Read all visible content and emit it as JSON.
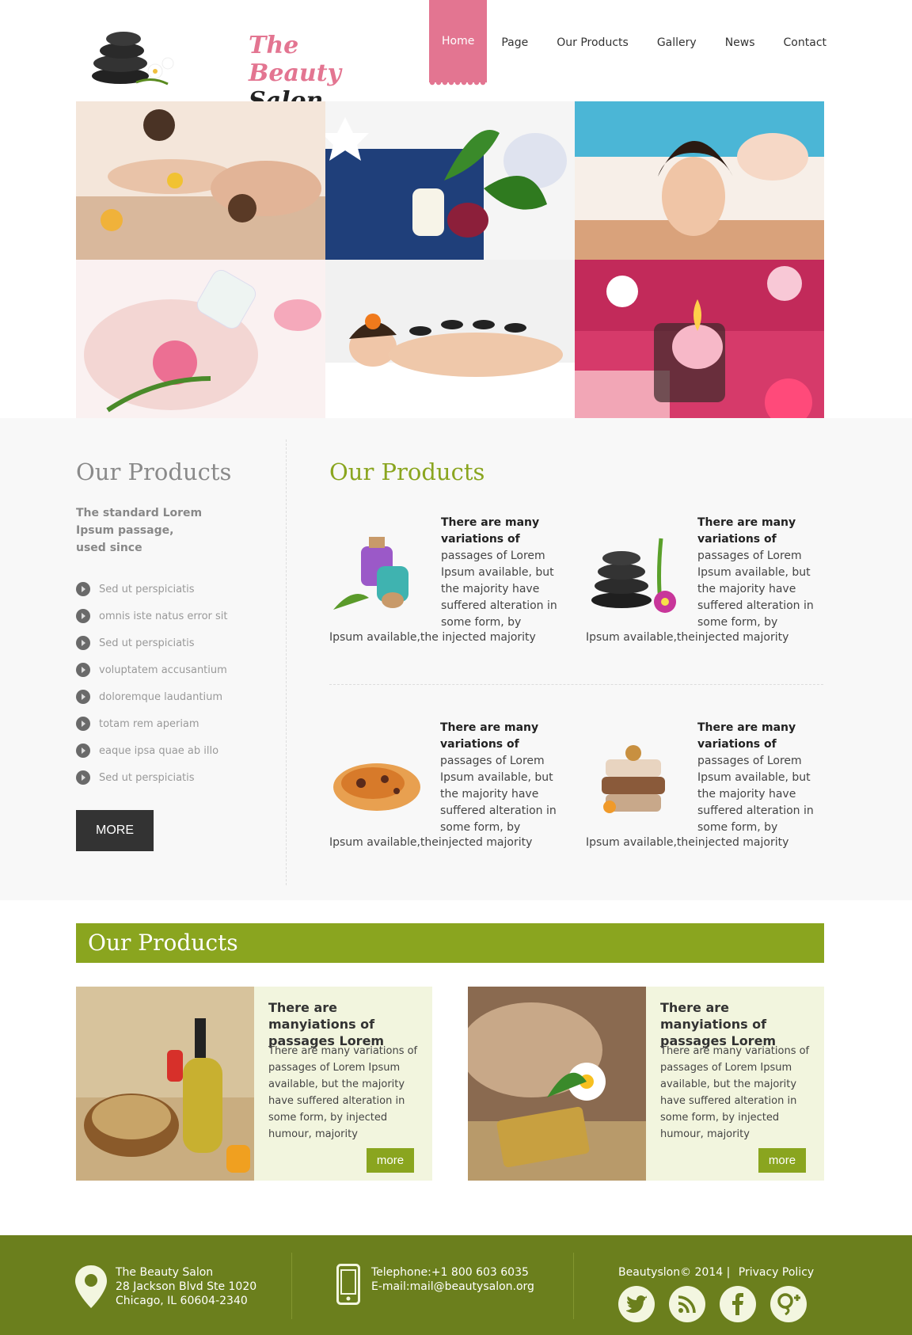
{
  "logo": {
    "part1": "The Beauty",
    "part2": "Salon"
  },
  "nav": [
    {
      "label": "Home"
    },
    {
      "label": "Page"
    },
    {
      "label": "Our Products"
    },
    {
      "label": "Gallery"
    },
    {
      "label": "News"
    },
    {
      "label": "Contact"
    }
  ],
  "sidebar": {
    "title": "Our Products",
    "subtitle": "The standard Lorem Ipsum passage, used since",
    "items": [
      "Sed ut perspiciatis",
      "omnis iste natus error sit",
      "Sed ut perspiciatis",
      "voluptatem accusantium",
      "doloremque laudantium",
      "totam rem aperiam",
      "eaque ipsa quae ab illo",
      "Sed ut perspiciatis"
    ],
    "more_label": "MORE"
  },
  "main": {
    "title": "Our Products",
    "products": [
      {
        "bold": "There are many variations of",
        "text": "passages of Lorem Ipsum available, but the majority have suffered alteration in some form, by",
        "last": "Ipsum available,the  injected majority"
      },
      {
        "bold": "There are many variations of",
        "text": "passages of Lorem Ipsum available, but the majority have suffered alteration in some form, by",
        "last": "Ipsum available,theinjected majority"
      },
      {
        "bold": "There are many variations of",
        "text": "passages of Lorem Ipsum available, but the majority have suffered alteration in some form, by",
        "last": "Ipsum available,theinjected majority"
      },
      {
        "bold": "There are many variations of",
        "text": "passages of Lorem Ipsum available, but the majority have suffered alteration in some form, by",
        "last": "Ipsum available,theinjected  majority"
      }
    ]
  },
  "featured": {
    "title": "Our Products",
    "cards": [
      {
        "title": "There are manyiations of passages Lorem",
        "body": "There are many variations of passages of Lorem Ipsum available, but the majority have suffered alteration in some form, by injected humour, majority",
        "more": "more"
      },
      {
        "title": "There are manyiations of passages Lorem",
        "body": "There are many variations of passages of Lorem Ipsum available, but the majority have suffered alteration in some form, by injected humour, majority",
        "more": "more"
      }
    ]
  },
  "footer": {
    "address": [
      "The Beauty Salon",
      "28 Jackson Blvd Ste 1020",
      "Chicago, IL 60604-2340"
    ],
    "telephone": "Telephone:+1 800 603 6035",
    "email": "E-mail:mail@beautysalon.org",
    "copyright": "Beautyslon© 2014 |",
    "privacy": "Privacy Policy",
    "social": [
      "twitter-icon",
      "rss-icon",
      "facebook-icon",
      "google-plus-icon"
    ]
  },
  "colors": {
    "pink": "#e37591",
    "green": "#8aa51f",
    "footer": "#6b7f1d"
  }
}
